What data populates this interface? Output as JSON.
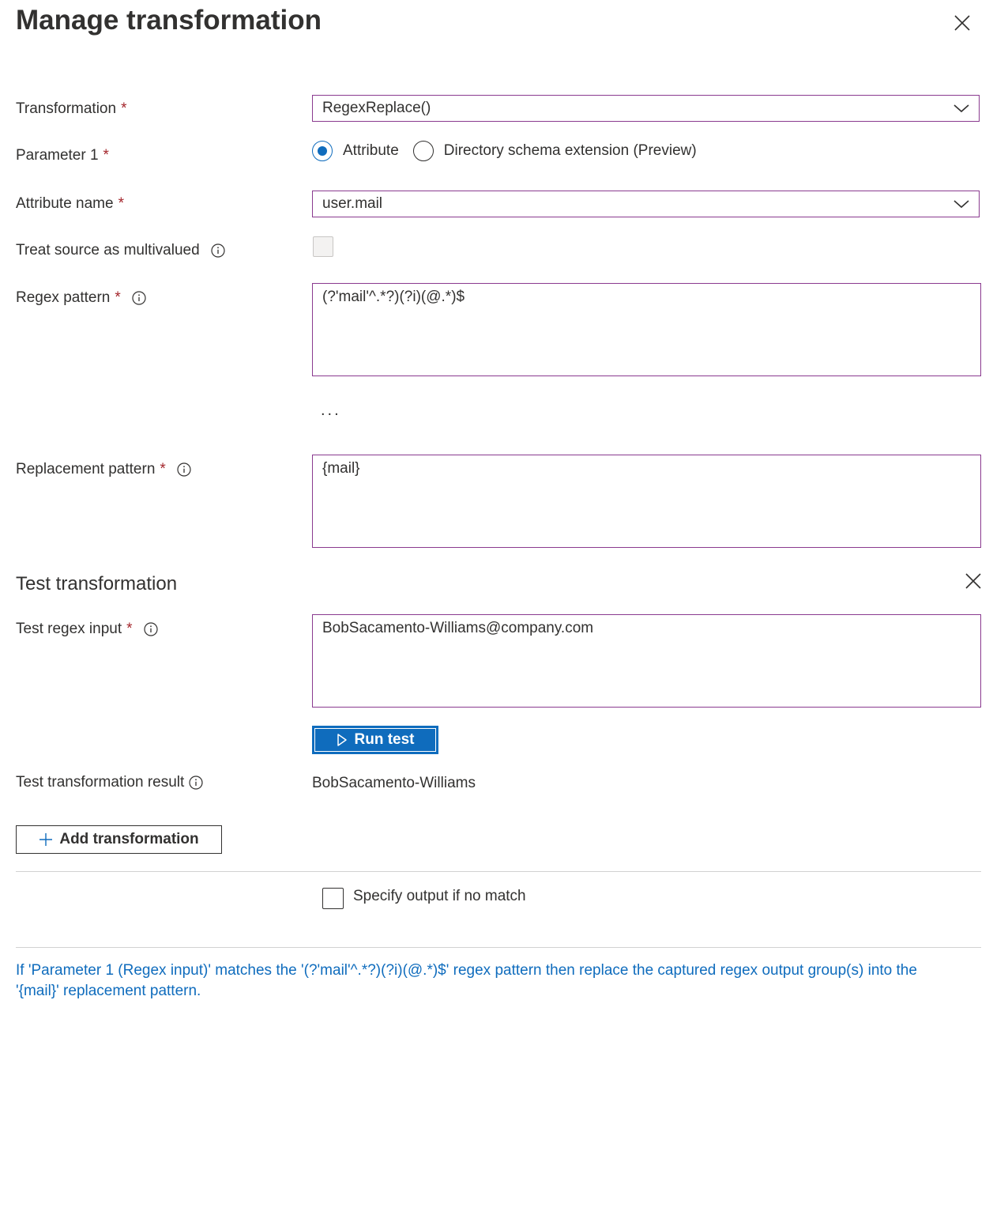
{
  "header": {
    "title": "Manage transformation"
  },
  "form": {
    "transformation": {
      "label": "Transformation",
      "required_mark": "*",
      "value": "RegexReplace()"
    },
    "parameter1": {
      "label": "Parameter 1",
      "required_mark": "*",
      "options": [
        {
          "label": "Attribute",
          "selected": true
        },
        {
          "label": "Directory schema extension (Preview)",
          "selected": false
        }
      ]
    },
    "attribute_name": {
      "label": "Attribute name",
      "required_mark": "*",
      "value": "user.mail"
    },
    "treat_multivalued": {
      "label": "Treat source as multivalued",
      "checked": false,
      "disabled": true
    },
    "regex_pattern": {
      "label": "Regex pattern",
      "required_mark": "*",
      "value": "(?'mail'^.*?)(?i)(@.*)$"
    },
    "more": "...",
    "replacement_pattern": {
      "label": "Replacement pattern",
      "required_mark": "*",
      "value": "{mail}"
    }
  },
  "test": {
    "title": "Test transformation",
    "input": {
      "label": "Test regex input",
      "required_mark": "*",
      "value": "BobSacamento-Williams@company.com"
    },
    "run_button": "Run test",
    "result": {
      "label": "Test transformation result",
      "value": "BobSacamento-Williams"
    }
  },
  "actions": {
    "add_transformation": "Add transformation"
  },
  "output_if_no_match": {
    "label": "Specify output if no match",
    "checked": false
  },
  "description": "If 'Parameter 1 (Regex input)' matches the '(?'mail'^.*?)(?i)(@.*)$' regex pattern then replace the captured regex output group(s) into the '{mail}' replacement pattern.",
  "colors": {
    "accent": "#0f6cbd",
    "focus_border": "#8a3a8f",
    "required": "#a4262c",
    "text": "#323130"
  },
  "icons": {
    "close": "close-icon",
    "dropdown": "chevron-down-icon",
    "info": "info-icon",
    "play": "play-icon",
    "add": "plus-icon"
  }
}
